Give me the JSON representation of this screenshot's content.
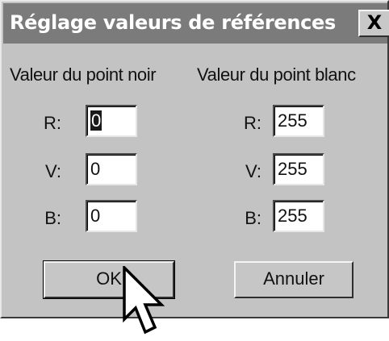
{
  "dialog": {
    "title": "Réglage valeurs de références",
    "close_glyph": "X"
  },
  "black_point": {
    "header": "Valeur du point noir",
    "rows": [
      {
        "label": "R:",
        "value": "0",
        "selected": true
      },
      {
        "label": "V:",
        "value": "0"
      },
      {
        "label": "B:",
        "value": "0"
      }
    ]
  },
  "white_point": {
    "header": "Valeur du point blanc",
    "rows": [
      {
        "label": "R:",
        "value": "255"
      },
      {
        "label": "V:",
        "value": "255"
      },
      {
        "label": "B:",
        "value": "255"
      }
    ]
  },
  "buttons": {
    "ok": "OK",
    "cancel": "Annuler"
  },
  "cursor": {
    "icon": "mouse-pointer-icon"
  }
}
